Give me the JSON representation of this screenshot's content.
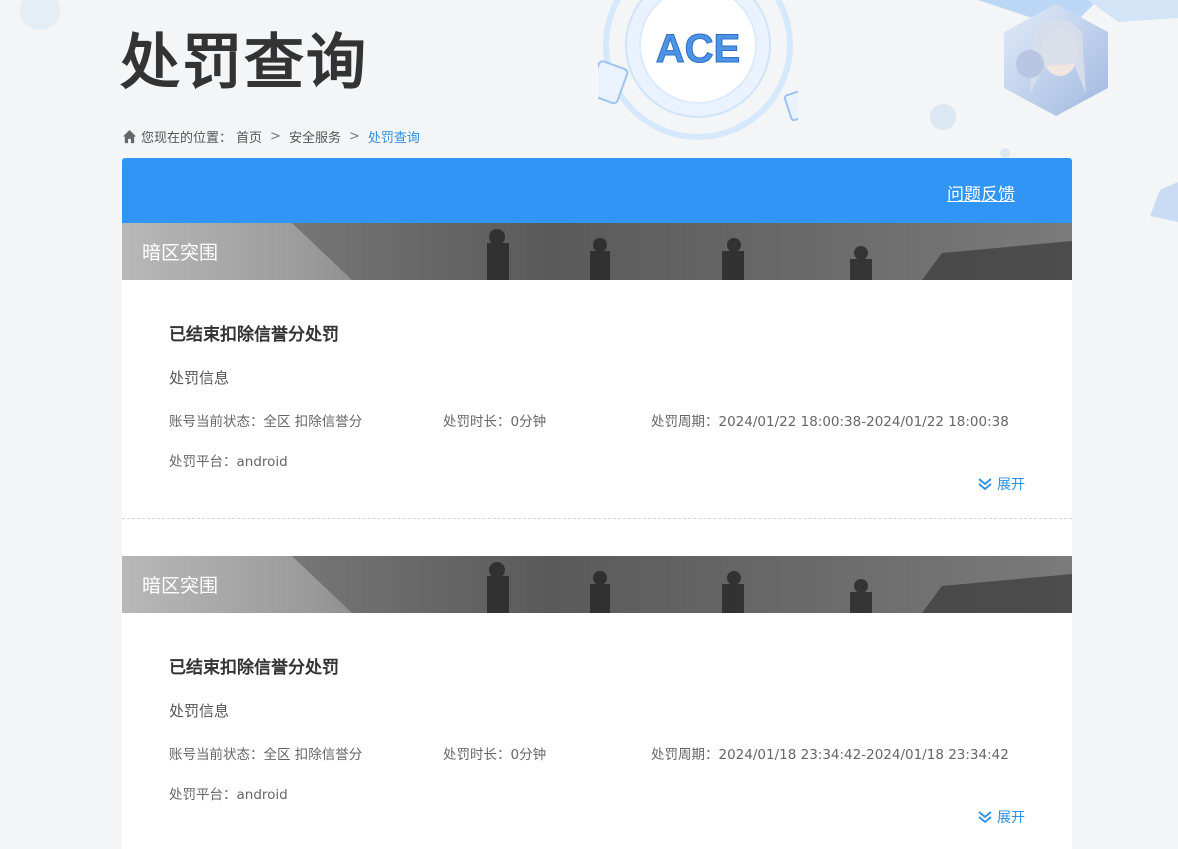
{
  "page": {
    "title": "处罚查询"
  },
  "breadcrumb": {
    "prefix": "您现在的位置：",
    "items": [
      "首页",
      "安全服务",
      "处罚查询"
    ],
    "separator": ">"
  },
  "panel": {
    "feedback_label": "问题反馈"
  },
  "records": [
    {
      "game": "暗区突围",
      "title": "已结束扣除信誉分处罚",
      "info_label": "处罚信息",
      "status": "账号当前状态：全区 扣除信誉分",
      "duration": "处罚时长：0分钟",
      "period": "处罚周期：2024/01/22 18:00:38-2024/01/22 18:00:38",
      "platform": "处罚平台：android",
      "expand_label": "展开"
    },
    {
      "game": "暗区突围",
      "title": "已结束扣除信誉分处罚",
      "info_label": "处罚信息",
      "status": "账号当前状态：全区 扣除信誉分",
      "duration": "处罚时长：0分钟",
      "period": "处罚周期：2024/01/18 23:34:42-2024/01/18 23:34:42",
      "platform": "处罚平台：android",
      "expand_label": "展开"
    }
  ],
  "colors": {
    "accent": "#3195f5",
    "link": "#2d8fe6"
  },
  "icons": [
    "home-icon",
    "double-chevron-down-icon",
    "ace-logo",
    "character-avatar"
  ]
}
